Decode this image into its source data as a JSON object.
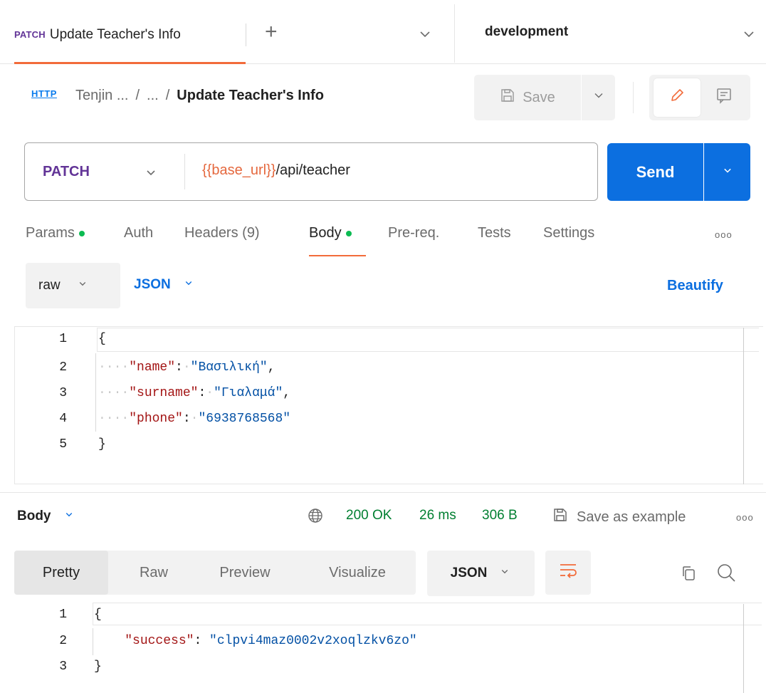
{
  "tab": {
    "method": "PATCH",
    "title": "Update Teacher's Info",
    "new_tab": "+"
  },
  "environment": {
    "name": "development"
  },
  "breadcrumb": {
    "protocol": "HTTP",
    "collection": "Tenjin ...",
    "sep1": "/",
    "folder": "...",
    "sep2": "/",
    "current": "Update Teacher's Info"
  },
  "toolbar": {
    "save_label": "Save"
  },
  "request": {
    "method": "PATCH",
    "url_variable": "{{base_url}}",
    "url_path": "/api/teacher",
    "send_label": "Send"
  },
  "request_tabs": [
    {
      "label": "Params",
      "has_dot": true
    },
    {
      "label": "Auth",
      "has_dot": false
    },
    {
      "label": "Headers (9)",
      "has_dot": false
    },
    {
      "label": "Body",
      "has_dot": true,
      "active": true
    },
    {
      "label": "Pre-req.",
      "has_dot": false
    },
    {
      "label": "Tests",
      "has_dot": false
    },
    {
      "label": "Settings",
      "has_dot": false
    }
  ],
  "more_label": "ooo",
  "body_options": {
    "mode": "raw",
    "language": "JSON",
    "beautify_label": "Beautify"
  },
  "request_body": {
    "line_numbers": [
      "1",
      "2",
      "3",
      "4",
      "5"
    ],
    "open_brace": "{",
    "close_brace": "}",
    "fields": [
      {
        "key": "\"name\"",
        "value": "\"Βασιλική\"",
        "trailing": ","
      },
      {
        "key": "\"surname\"",
        "value": "\"Γιαλαμά\"",
        "trailing": ","
      },
      {
        "key": "\"phone\"",
        "value": "\"6938768568\"",
        "trailing": ""
      }
    ]
  },
  "response": {
    "section_label": "Body",
    "status": "200 OK",
    "time": "26 ms",
    "size": "306 B",
    "save_example_label": "Save as example",
    "view_tabs": [
      "Pretty",
      "Raw",
      "Preview",
      "Visualize"
    ],
    "active_view": "Pretty",
    "format": "JSON",
    "line_numbers": [
      "1",
      "2",
      "3"
    ],
    "open_brace": "{",
    "close_brace": "}",
    "key": "\"success\"",
    "value": "\"clpvi4maz0002v2xoqlzkv6zo\""
  },
  "colors": {
    "accent_orange": "#f26b3a",
    "send_blue": "#0c6fe0",
    "method_purple": "#623497",
    "status_green": "#007f31",
    "dot_green": "#0cbb52"
  }
}
